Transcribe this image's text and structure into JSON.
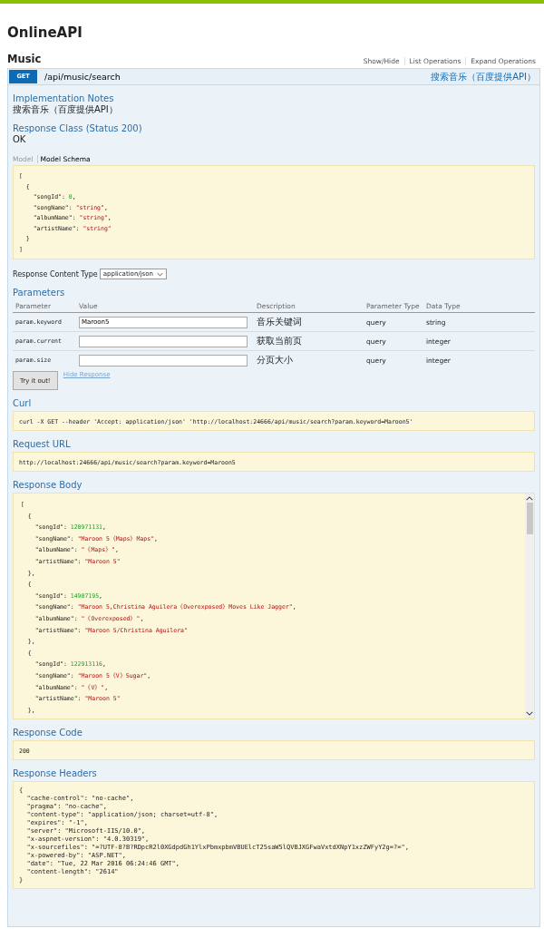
{
  "title": "OnlineAPI",
  "resource": {
    "name": "Music",
    "links": [
      "Show/Hide",
      "List Operations",
      "Expand Operations"
    ]
  },
  "operation": {
    "method": "GET",
    "path": "/api/music/search",
    "summary": "搜索音乐（百度提供API）"
  },
  "implementation_notes": {
    "heading": "Implementation Notes",
    "text": "搜索音乐（百度提供API）"
  },
  "response_class": {
    "heading": "Response Class (Status 200)",
    "text": "OK",
    "tabs": [
      {
        "label": "Model",
        "selected": false
      },
      {
        "label": "Model Schema",
        "selected": true
      }
    ],
    "schema_lines": [
      [
        {
          "kind": "plain",
          "text": "["
        }
      ],
      [
        {
          "kind": "plain",
          "text": "  {"
        }
      ],
      [
        {
          "kind": "plain",
          "text": "    \"songId\": "
        },
        {
          "kind": "number",
          "text": "0"
        },
        {
          "kind": "plain",
          "text": ","
        }
      ],
      [
        {
          "kind": "plain",
          "text": "    \"songName\": "
        },
        {
          "kind": "string",
          "text": "\"string\""
        },
        {
          "kind": "plain",
          "text": ","
        }
      ],
      [
        {
          "kind": "plain",
          "text": "    \"albumName\": "
        },
        {
          "kind": "string",
          "text": "\"string\""
        },
        {
          "kind": "plain",
          "text": ","
        }
      ],
      [
        {
          "kind": "plain",
          "text": "    \"artistName\": "
        },
        {
          "kind": "string",
          "text": "\"string\""
        }
      ],
      [
        {
          "kind": "plain",
          "text": "  }"
        }
      ],
      [
        {
          "kind": "plain",
          "text": "]"
        }
      ]
    ]
  },
  "content_type": {
    "label": "Response Content Type",
    "value": "application/json"
  },
  "parameters": {
    "heading": "Parameters",
    "columns": [
      "Parameter",
      "Value",
      "Description",
      "Parameter Type",
      "Data Type"
    ],
    "rows": [
      {
        "name": "param.keyword",
        "value": "Maroon5",
        "description": "音乐关键词",
        "parameter_type": "query",
        "data_type": "string"
      },
      {
        "name": "param.current",
        "description": "获取当前页",
        "parameter_type": "query",
        "data_type": "integer"
      },
      {
        "name": "param.size",
        "description": "分页大小",
        "parameter_type": "query",
        "data_type": "integer"
      }
    ]
  },
  "actions": {
    "submit": "Try it out!",
    "hide_link": "Hide Response"
  },
  "curl": {
    "heading": "Curl",
    "text": "curl -X GET --header 'Accept: application/json' 'http://localhost:24666/api/music/search?param.keyword=Maroon5'"
  },
  "request_url": {
    "heading": "Request URL",
    "text": "http://localhost:24666/api/music/search?param.keyword=Maroon5"
  },
  "response_body": {
    "heading": "Response Body",
    "lines": [
      [
        {
          "kind": "plain",
          "text": "["
        }
      ],
      [
        {
          "kind": "plain",
          "text": "  {"
        }
      ],
      [
        {
          "kind": "plain",
          "text": "    \"songId\": "
        },
        {
          "kind": "number",
          "text": "120971131"
        },
        {
          "kind": "plain",
          "text": ","
        }
      ],
      [
        {
          "kind": "plain",
          "text": "    \"songName\": "
        },
        {
          "kind": "string",
          "text": "\"Maroon 5《Maps》Maps\""
        },
        {
          "kind": "plain",
          "text": ","
        }
      ],
      [
        {
          "kind": "plain",
          "text": "    \"albumName\": "
        },
        {
          "kind": "string",
          "text": "\"《Maps》\""
        },
        {
          "kind": "plain",
          "text": ","
        }
      ],
      [
        {
          "kind": "plain",
          "text": "    \"artistName\": "
        },
        {
          "kind": "string",
          "text": "\"Maroon 5\""
        }
      ],
      [
        {
          "kind": "plain",
          "text": "  },"
        }
      ],
      [
        {
          "kind": "plain",
          "text": "  {"
        }
      ],
      [
        {
          "kind": "plain",
          "text": "    \"songId\": "
        },
        {
          "kind": "number",
          "text": "14907195"
        },
        {
          "kind": "plain",
          "text": ","
        }
      ],
      [
        {
          "kind": "plain",
          "text": "    \"songName\": "
        },
        {
          "kind": "string",
          "text": "\"Maroon 5,Christina Aguilera《Overexposed》Moves Like Jagger\""
        },
        {
          "kind": "plain",
          "text": ","
        }
      ],
      [
        {
          "kind": "plain",
          "text": "    \"albumName\": "
        },
        {
          "kind": "string",
          "text": "\"《Overexposed》\""
        },
        {
          "kind": "plain",
          "text": ","
        }
      ],
      [
        {
          "kind": "plain",
          "text": "    \"artistName\": "
        },
        {
          "kind": "string",
          "text": "\"Maroon 5/Christina Aguilera\""
        }
      ],
      [
        {
          "kind": "plain",
          "text": "  },"
        }
      ],
      [
        {
          "kind": "plain",
          "text": "  {"
        }
      ],
      [
        {
          "kind": "plain",
          "text": "    \"songId\": "
        },
        {
          "kind": "number",
          "text": "122913116"
        },
        {
          "kind": "plain",
          "text": ","
        }
      ],
      [
        {
          "kind": "plain",
          "text": "    \"songName\": "
        },
        {
          "kind": "string",
          "text": "\"Maroon 5《V》Sugar\""
        },
        {
          "kind": "plain",
          "text": ","
        }
      ],
      [
        {
          "kind": "plain",
          "text": "    \"albumName\": "
        },
        {
          "kind": "string",
          "text": "\"《V》\""
        },
        {
          "kind": "plain",
          "text": ","
        }
      ],
      [
        {
          "kind": "plain",
          "text": "    \"artistName\": "
        },
        {
          "kind": "string",
          "text": "\"Maroon 5\""
        }
      ],
      [
        {
          "kind": "plain",
          "text": "  },"
        }
      ]
    ]
  },
  "response_code": {
    "heading": "Response Code",
    "text": "200"
  },
  "response_headers": {
    "heading": "Response Headers",
    "lines": [
      "{",
      "  \"cache-control\": \"no-cache\",",
      "  \"pragma\": \"no-cache\",",
      "  \"content-type\": \"application/json; charset=utf-8\",",
      "  \"expires\": \"-1\",",
      "  \"server\": \"Microsoft-IIS/10.0\",",
      "  \"x-aspnet-version\": \"4.0.30319\",",
      "  \"x-sourcefiles\": \"=?UTF-8?B?RDpcR2l0XGdpdGh1YlxPbmxpbmVBUElcT25saW5lQVBJXGFwaVxtdXNpY1xzZWFyY2g=?=\",",
      "  \"x-powered-by\": \"ASP.NET\",",
      "  \"date\": \"Tue, 22 Mar 2016 06:24:46 GMT\",",
      "  \"content-length\": \"2614\"",
      "}"
    ]
  }
}
